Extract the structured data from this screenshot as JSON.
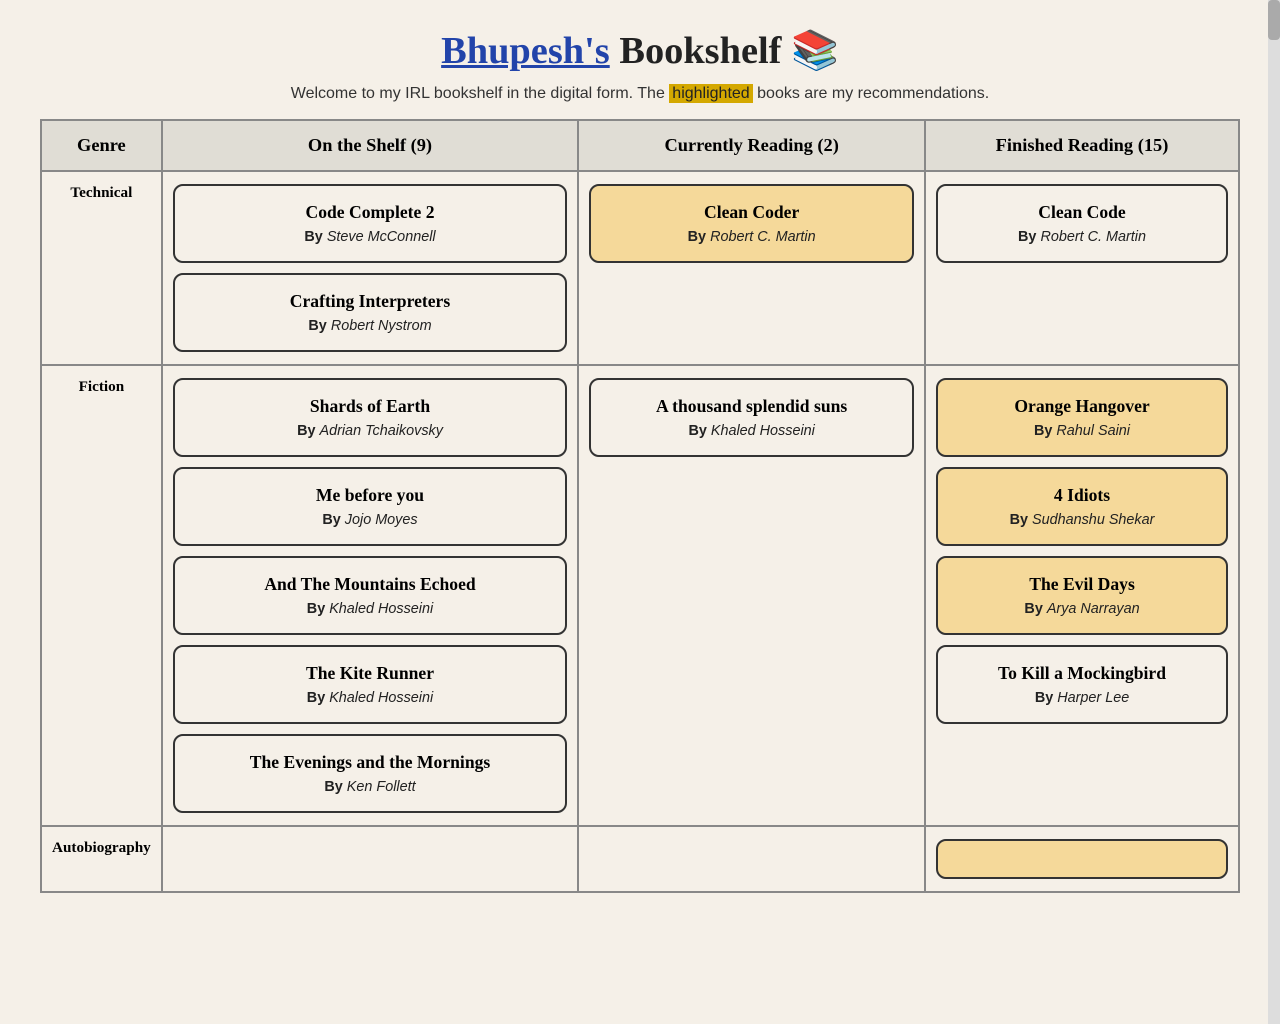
{
  "header": {
    "title_underline": "Bhupesh's",
    "title_rest": " Bookshelf 📚",
    "subtitle_before": "Welcome to my IRL bookshelf in the digital form. The ",
    "subtitle_highlight": "highlighted",
    "subtitle_after": " books are my recommendations."
  },
  "table": {
    "col_genre": "Genre",
    "col_shelf": "On the Shelf (9)",
    "col_reading": "Currently Reading (2)",
    "col_finished": "Finished Reading (15)"
  },
  "rows": [
    {
      "genre": "Technical",
      "shelf": [
        {
          "title": "Code Complete 2",
          "author": "Steve McConnell",
          "highlighted": false
        },
        {
          "title": "Crafting Interpreters",
          "author": "Robert Nystrom",
          "highlighted": false
        }
      ],
      "reading": [
        {
          "title": "Clean Coder",
          "author": "Robert C. Martin",
          "highlighted": true
        }
      ],
      "finished": [
        {
          "title": "Clean Code",
          "author": "Robert C. Martin",
          "highlighted": false
        }
      ]
    },
    {
      "genre": "Fiction",
      "shelf": [
        {
          "title": "Shards of Earth",
          "author": "Adrian Tchaikovsky",
          "highlighted": false
        },
        {
          "title": "Me before you",
          "author": "Jojo Moyes",
          "highlighted": false
        },
        {
          "title": "And The Mountains Echoed",
          "author": "Khaled Hosseini",
          "highlighted": false
        },
        {
          "title": "The Kite Runner",
          "author": "Khaled Hosseini",
          "highlighted": false
        },
        {
          "title": "The Evenings and the Mornings",
          "author": "Ken Follett",
          "highlighted": false
        }
      ],
      "reading": [
        {
          "title": "A thousand splendid suns",
          "author": "Khaled Hosseini",
          "highlighted": false
        }
      ],
      "finished": [
        {
          "title": "Orange Hangover",
          "author": "Rahul Saini",
          "highlighted": true
        },
        {
          "title": "4 Idiots",
          "author": "Sudhanshu Shekar",
          "highlighted": true
        },
        {
          "title": "The Evil Days",
          "author": "Arya Narrayan",
          "highlighted": true
        },
        {
          "title": "To Kill a Mockingbird",
          "author": "Harper Lee",
          "highlighted": false
        }
      ]
    },
    {
      "genre": "Autobiography",
      "shelf": [],
      "reading": [],
      "finished": []
    }
  ]
}
